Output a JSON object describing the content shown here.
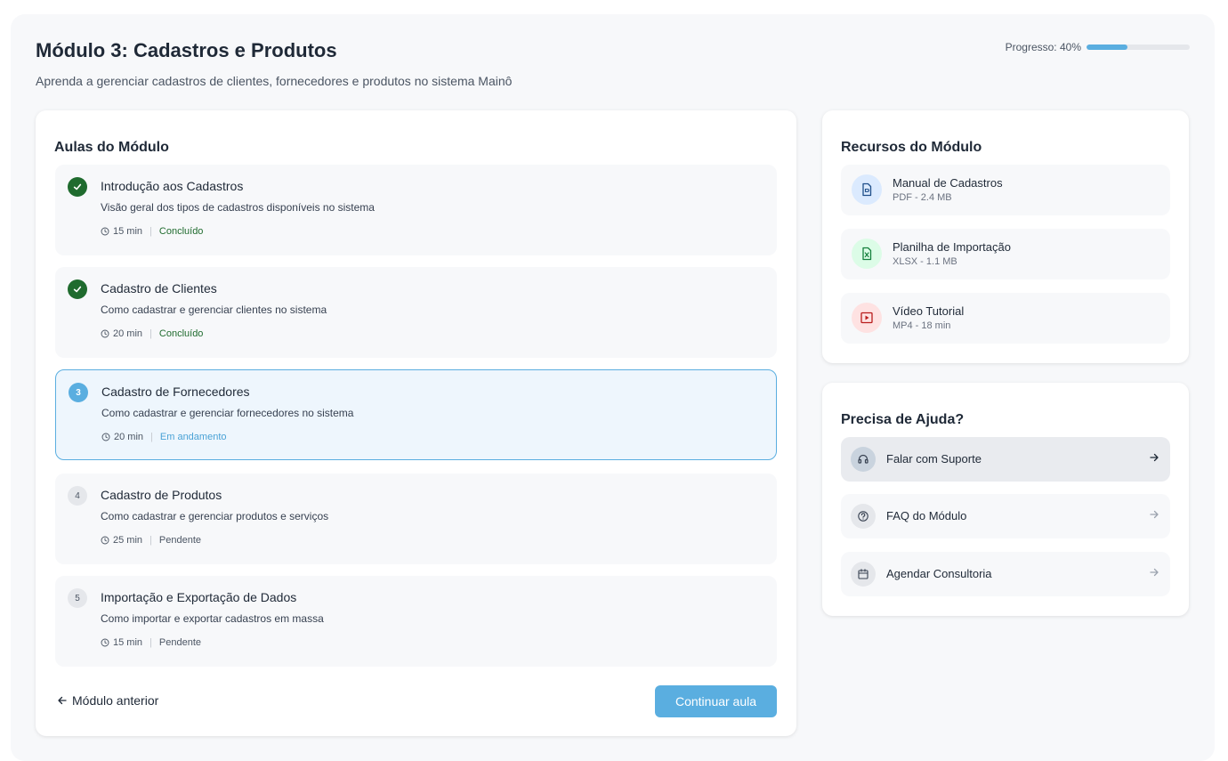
{
  "header": {
    "title": "Módulo 3: Cadastros e Produtos",
    "subtitle": "Aprenda a gerenciar cadastros de clientes, fornecedores e produtos no sistema Mainô",
    "progress_label": "Progresso: 40%",
    "progress_value": 0.4
  },
  "lessons": {
    "title": "Aulas do Módulo",
    "items": [
      {
        "badge": "",
        "state": "done",
        "title": "Introdução aos Cadastros",
        "description": "Visão geral dos tipos de cadastros disponíveis no sistema",
        "duration": "15 min",
        "status": "Concluído"
      },
      {
        "badge": "",
        "state": "done",
        "title": "Cadastro de Clientes",
        "description": "Como cadastrar e gerenciar clientes no sistema",
        "duration": "20 min",
        "status": "Concluído"
      },
      {
        "badge": "3",
        "state": "current",
        "title": "Cadastro de Fornecedores",
        "description": "Como cadastrar e gerenciar fornecedores no sistema",
        "duration": "20 min",
        "status": "Em andamento"
      },
      {
        "badge": "4",
        "state": "pending",
        "title": "Cadastro de Produtos",
        "description": "Como cadastrar e gerenciar produtos e serviços",
        "duration": "25 min",
        "status": "Pendente"
      },
      {
        "badge": "5",
        "state": "pending",
        "title": "Importação e Exportação de Dados",
        "description": "Como importar e exportar cadastros em massa",
        "duration": "15 min",
        "status": "Pendente"
      }
    ],
    "prev_label": "Módulo anterior",
    "continue_label": "Continuar aula"
  },
  "resources": {
    "title": "Recursos do Módulo",
    "items": [
      {
        "name": "Manual de Cadastros",
        "meta": "PDF - 2.4 MB",
        "icon": "document-icon",
        "color": "#1f4f8a",
        "bg": "#dbeafe"
      },
      {
        "name": "Planilha de Importação",
        "meta": "XLSX - 1.1 MB",
        "icon": "spreadsheet-icon",
        "color": "#15803d",
        "bg": "#dcfce7"
      },
      {
        "name": "Vídeo Tutorial",
        "meta": "MP4 - 18 min",
        "icon": "video-icon",
        "color": "#b91c1c",
        "bg": "#fee2e2"
      }
    ]
  },
  "help": {
    "title": "Precisa de Ajuda?",
    "items": [
      {
        "label": "Falar com Suporte",
        "icon": "headset-icon"
      },
      {
        "label": "FAQ do Módulo",
        "icon": "question-icon"
      },
      {
        "label": "Agendar Consultoria",
        "icon": "calendar-icon"
      }
    ]
  },
  "colors": {
    "accent": "#5aaee0",
    "done": "#1f6b2e",
    "active_bg": "#eef6fd"
  }
}
